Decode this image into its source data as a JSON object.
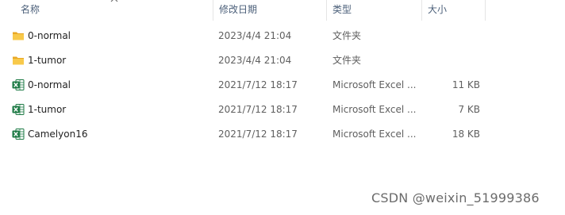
{
  "columns": {
    "name": "名称",
    "date": "修改日期",
    "type": "类型",
    "size": "大小"
  },
  "rows": [
    {
      "name": "0-normal",
      "date": "2023/4/4 21:04",
      "type": "文件夹",
      "size": "",
      "icon": "folder-icon"
    },
    {
      "name": "1-tumor",
      "date": "2023/4/4 21:04",
      "type": "文件夹",
      "size": "",
      "icon": "folder-icon"
    },
    {
      "name": "0-normal",
      "date": "2021/7/12 18:17",
      "type": "Microsoft Excel ...",
      "size": "11 KB",
      "icon": "excel-file-icon"
    },
    {
      "name": "1-tumor",
      "date": "2021/7/12 18:17",
      "type": "Microsoft Excel ...",
      "size": "7 KB",
      "icon": "excel-file-icon"
    },
    {
      "name": "Camelyon16",
      "date": "2021/7/12 18:17",
      "type": "Microsoft Excel ...",
      "size": "18 KB",
      "icon": "excel-file-icon"
    }
  ],
  "watermark": "CSDN @weixin_51999386",
  "colors": {
    "folder": "#f8c94a",
    "excel": "#1d7a45"
  }
}
